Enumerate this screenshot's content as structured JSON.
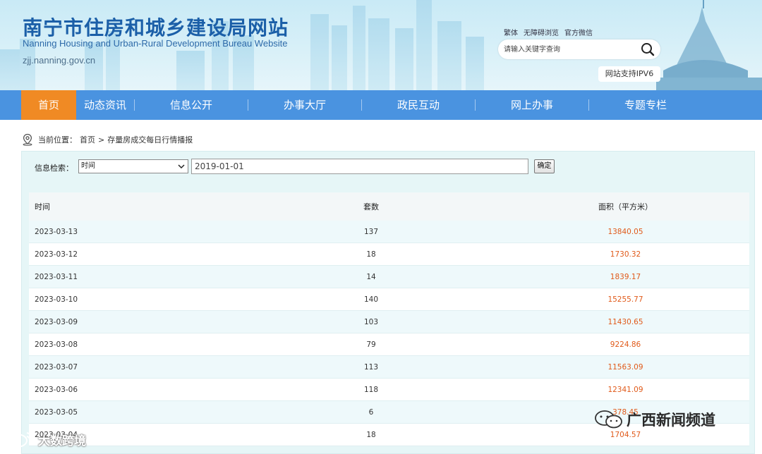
{
  "header": {
    "title": "南宁市住房和城乡建设局网站",
    "subtitle": "Nanning Housing and Urban-Rural Development Bureau Website",
    "url": "zjj.nanning.gov.cn",
    "top_links": [
      "繁体",
      "无障碍浏览",
      "官方微信"
    ],
    "search_placeholder": "请输入关键字查询",
    "ipv6_label": "网站支持IPV6"
  },
  "nav": {
    "items": [
      {
        "label": "首页",
        "active": true
      },
      {
        "label": "动态资讯"
      },
      {
        "label": "信息公开"
      },
      {
        "label": "办事大厅"
      },
      {
        "label": "政民互动"
      },
      {
        "label": "网上办事"
      },
      {
        "label": "专题专栏"
      }
    ]
  },
  "breadcrumb": {
    "prefix": "当前位置：",
    "home": "首页",
    "separator": ">",
    "current": "存量房成交每日行情播报"
  },
  "filter": {
    "label": "信息检索：",
    "select_value": "时间",
    "input_value": "2019-01-01",
    "button_label": "确定"
  },
  "table": {
    "headers": [
      "时间",
      "套数",
      "面积（平方米）"
    ],
    "rows": [
      [
        "2023-03-13",
        "137",
        "13840.05"
      ],
      [
        "2023-03-12",
        "18",
        "1730.32"
      ],
      [
        "2023-03-11",
        "14",
        "1839.17"
      ],
      [
        "2023-03-10",
        "140",
        "15255.77"
      ],
      [
        "2023-03-09",
        "103",
        "11430.65"
      ],
      [
        "2023-03-08",
        "79",
        "9224.86"
      ],
      [
        "2023-03-07",
        "113",
        "11563.09"
      ],
      [
        "2023-03-06",
        "118",
        "12341.09"
      ],
      [
        "2023-03-05",
        "6",
        "378.45"
      ],
      [
        "2023-03-04",
        "18",
        "1704.57"
      ]
    ]
  },
  "watermarks": {
    "right": "广西新闻频道",
    "left": "大数跨境"
  },
  "colors": {
    "nav_bg": "#4a93e0",
    "nav_active": "#f08a24",
    "title": "#1b5fa8",
    "area_value": "#e05a1a",
    "panel_bg": "#e6f6f7"
  }
}
